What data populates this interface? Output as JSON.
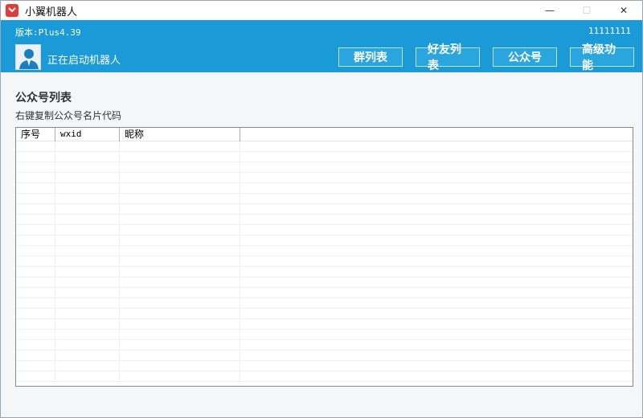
{
  "window": {
    "title": "小翼机器人",
    "controls": {
      "minimize": "—",
      "maximize": "☐",
      "close": "✕"
    }
  },
  "versionbar": {
    "version": "版本:Plus4.39",
    "account": "11111111"
  },
  "header": {
    "status": "正在启动机器人",
    "nav": [
      {
        "label": "群列表"
      },
      {
        "label": "好友列表"
      },
      {
        "label": "公众号"
      },
      {
        "label": "高级功能"
      }
    ]
  },
  "content": {
    "title": "公众号列表",
    "hint": "右键复制公众号名片代码",
    "table": {
      "columns": [
        "序号",
        "wxid",
        "昵称",
        ""
      ],
      "rows": []
    }
  },
  "colors": {
    "accent": "#1a9ad6",
    "app_icon": "#e23b3b"
  },
  "icons": {
    "app": "app-logo-icon",
    "avatar": "user-avatar-icon"
  }
}
